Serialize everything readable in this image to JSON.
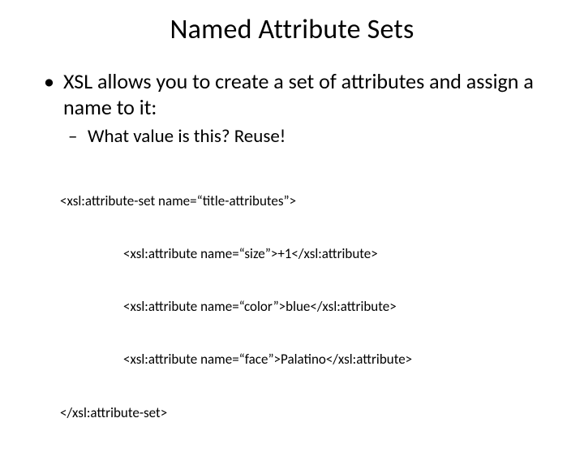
{
  "title": "Named Attribute Sets",
  "bullet1": "XSL allows you to create a set of attributes and assign a name to it:",
  "bullet1_sub1": "What value is this?  Reuse!",
  "code": {
    "l1": "<xsl:attribute-set name=“title-attributes”>",
    "l2": "<xsl:attribute name=“size”>+1</xsl:attribute>",
    "l3": "<xsl:attribute name=“color”>blue</xsl:attribute>",
    "l4": "<xsl:attribute name=“face”>Palatino</xsl:attribute>",
    "l5": "</xsl:attribute-set>"
  }
}
